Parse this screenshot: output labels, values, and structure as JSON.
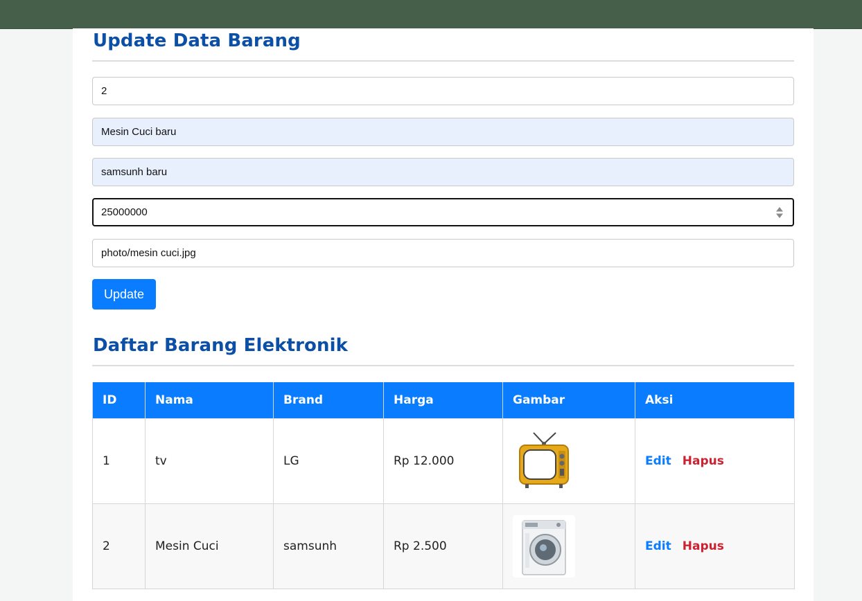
{
  "form": {
    "title": "Update Data Barang",
    "id_value": "2",
    "nama_value": "Mesin Cuci baru",
    "brand_value": "samsunh baru",
    "harga_value": "25000000",
    "gambar_value": "photo/mesin cuci.jpg",
    "update_label": "Update"
  },
  "list": {
    "title": "Daftar Barang Elektronik",
    "headers": [
      "ID",
      "Nama",
      "Brand",
      "Harga",
      "Gambar",
      "Aksi"
    ],
    "rows": [
      {
        "id": "1",
        "nama": "tv",
        "brand": "LG",
        "harga": "Rp 12.000",
        "image": "retro-tv-image",
        "edit": "Edit",
        "hapus": "Hapus"
      },
      {
        "id": "2",
        "nama": "Mesin Cuci",
        "brand": "samsunh",
        "harga": "Rp 2.500",
        "image": "washing-machine-image",
        "edit": "Edit",
        "hapus": "Hapus"
      }
    ]
  },
  "colors": {
    "topbar": "#465f4b",
    "heading": "#0b4fa6",
    "primary": "#0a7cff",
    "danger": "#cc2130",
    "autofill": "#e8f0fe"
  }
}
